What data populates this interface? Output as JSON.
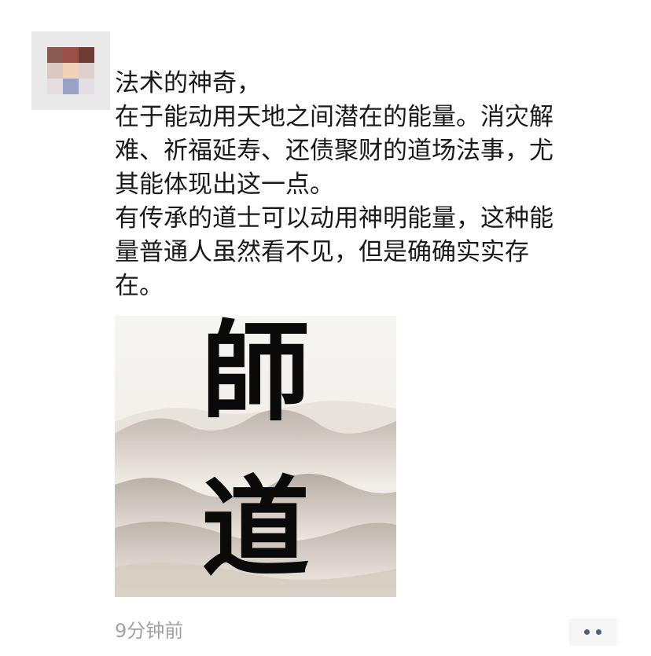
{
  "post": {
    "lines": [
      "法术的神奇，",
      "在于能动用天地之间潜在的能量。消灾解",
      "难、祈福延寿、还债聚财的道场法事，尤",
      "其能体现出这一点。",
      "有传承的道士可以动用神明能量，这种能",
      "量普通人虽然看不见，但是确确实实存",
      "在。"
    ],
    "image": {
      "calligraphy": [
        "師",
        "道"
      ],
      "ink_color": "#0a0a0a",
      "sky_color": "#f7f5f2",
      "mountain_color": "#cfc6bc"
    },
    "time": "9分钟前",
    "more_icon": "two-dots-icon",
    "more_dot_color": "#53607d"
  }
}
